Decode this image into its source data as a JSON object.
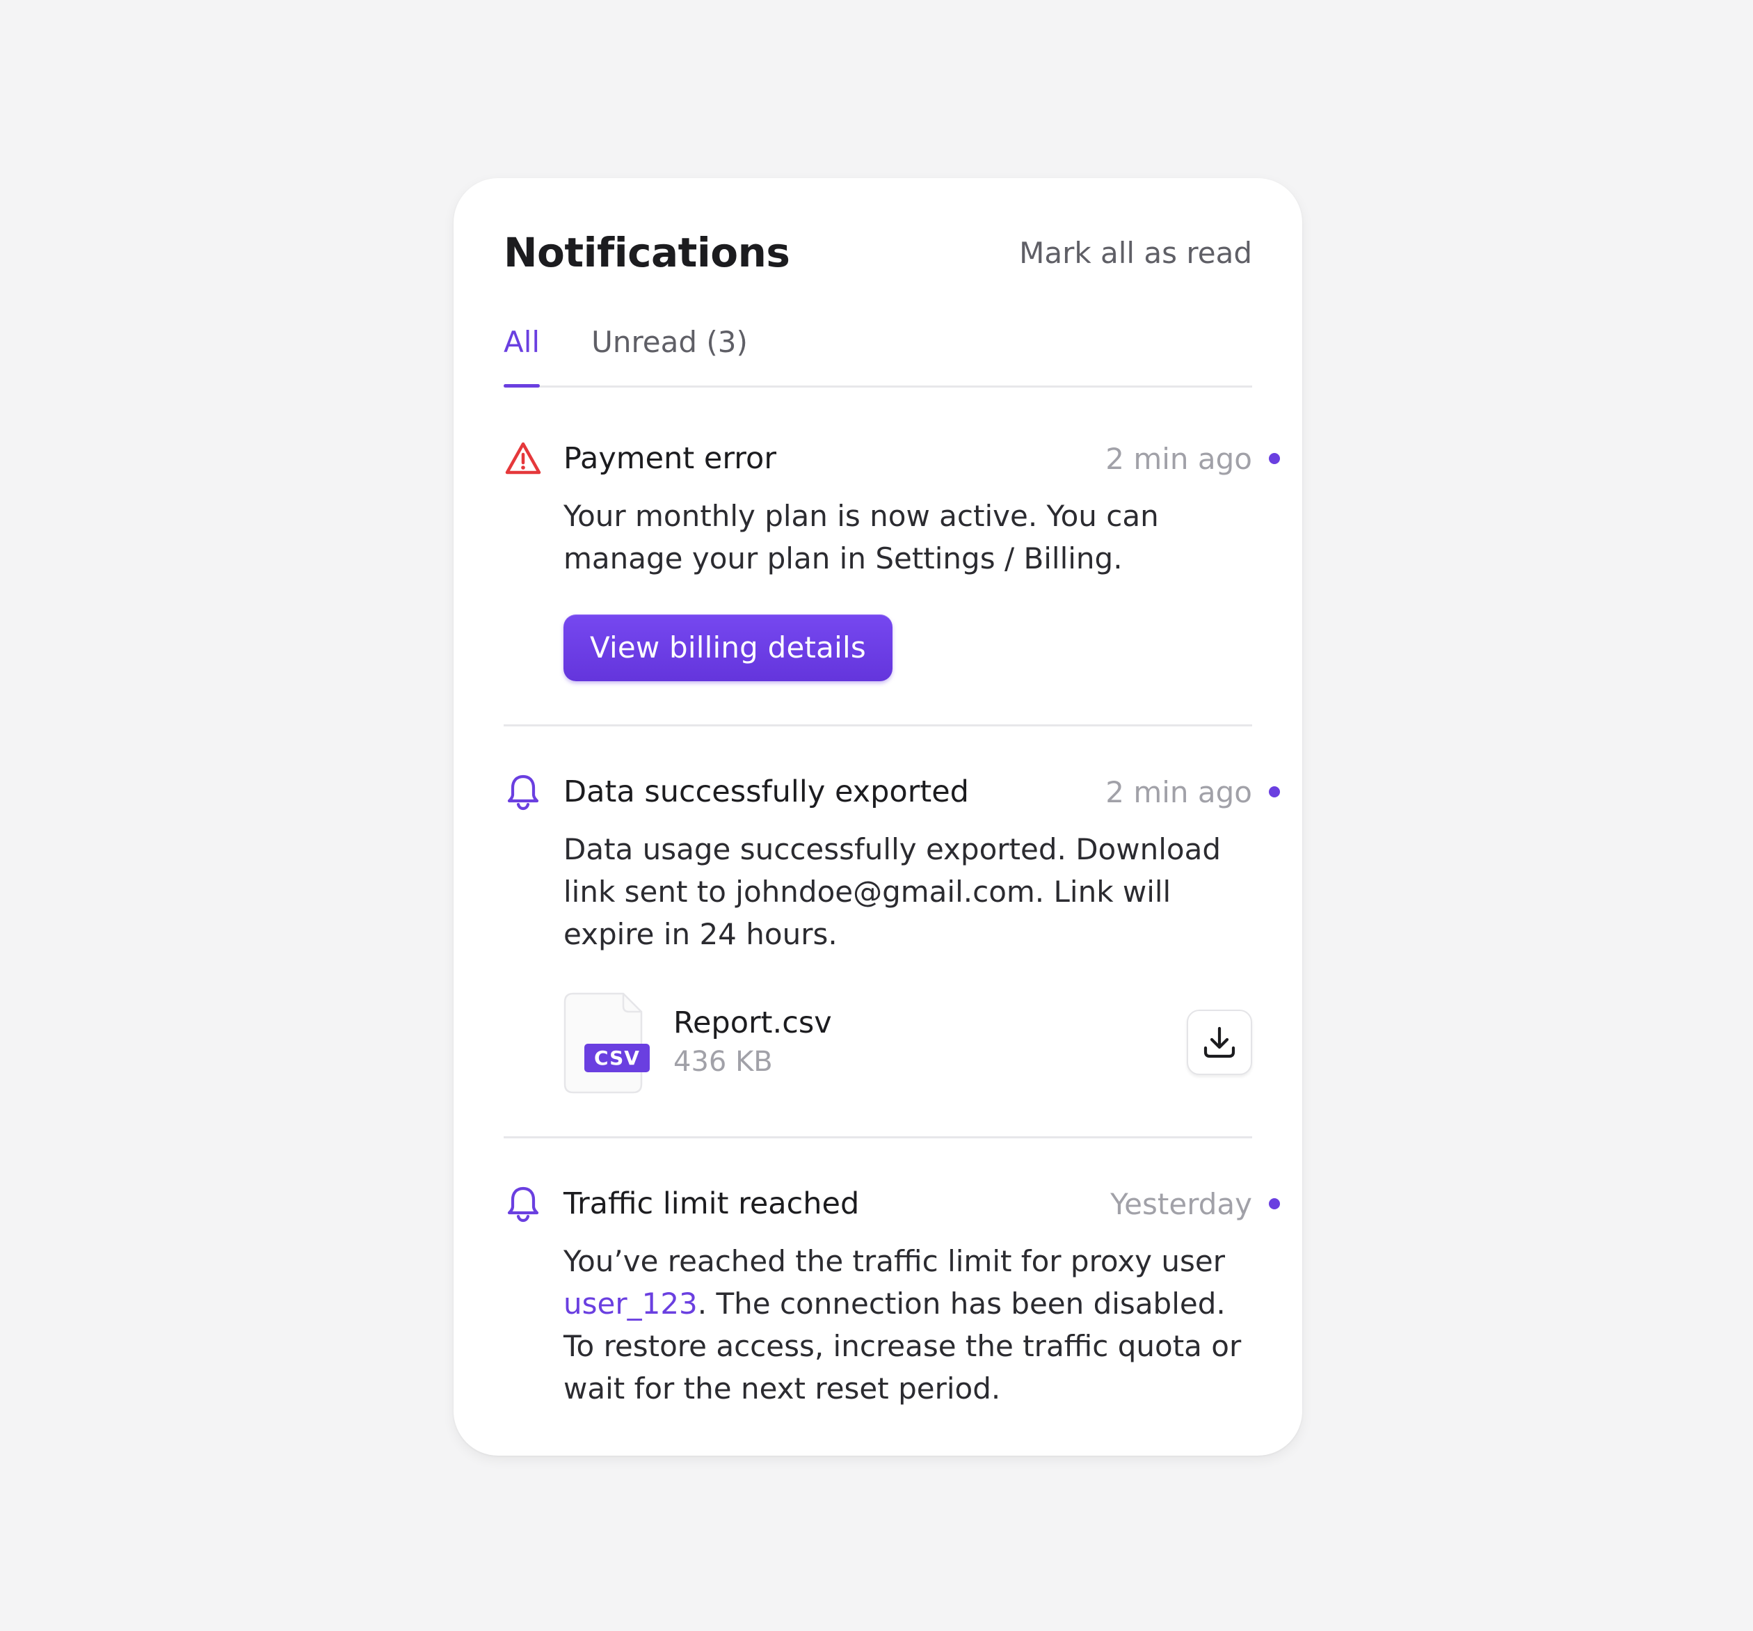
{
  "header": {
    "title": "Notifications",
    "mark_all_label": "Mark all as read"
  },
  "tabs": [
    {
      "label": "All",
      "active": true
    },
    {
      "label": "Unread (3)",
      "active": false
    }
  ],
  "notifications": [
    {
      "icon": "warning-triangle-icon",
      "title": "Payment error",
      "time": "2 min ago",
      "unread": true,
      "body": "Your monthly plan is now active. You can manage your plan in Settings / Billing.",
      "action_label": "View billing details"
    },
    {
      "icon": "bell-icon",
      "title": "Data successfully exported",
      "time": "2 min ago",
      "unread": true,
      "body": "Data usage successfully exported. Download link sent to johndoe@gmail.com. Link will expire in 24 hours.",
      "file": {
        "badge": "CSV",
        "name": "Report.csv",
        "size": "436 KB",
        "action_icon": "download-icon"
      }
    },
    {
      "icon": "bell-icon",
      "title": "Traffic limit reached",
      "time": "Yesterday",
      "unread": true,
      "body_before": "You’ve reached the traffic limit for proxy user ",
      "body_link": "user_123",
      "body_after": ". The connection has been disabled. To restore access, increase the traffic quota or wait for the next reset period."
    }
  ],
  "colors": {
    "accent": "#6a3fe0",
    "error": "#e5383b",
    "background": "#f4f4f5",
    "card": "#ffffff"
  }
}
